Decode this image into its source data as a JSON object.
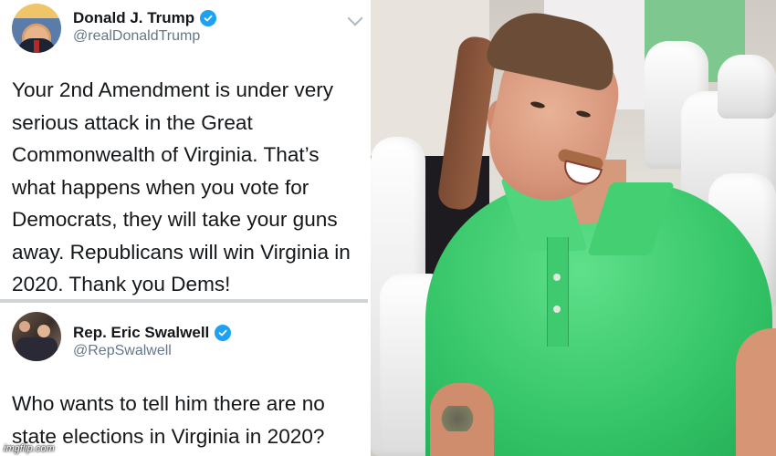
{
  "tweets": [
    {
      "name": "Donald J. Trump",
      "handle": "@realDonaldTrump",
      "text": "Your 2nd Amendment is under very serious attack in the Great Commonwealth of Virginia. That’s what happens when you vote for Democrats, they will take your guns away. Republicans will win Virginia in 2020. Thank you Dems!",
      "avatar_icon": "trump-avatar",
      "verified_icon": "verified-badge-icon"
    },
    {
      "name": "Rep. Eric Swalwell",
      "handle": "@RepSwalwell",
      "text": "Who wants to tell him there are no state elections in Virginia in 2020?",
      "avatar_icon": "swalwell-avatar",
      "verified_icon": "verified-badge-icon"
    }
  ],
  "photo": {
    "subject": "laughing-man-green-shirt"
  },
  "watermark": "imgflip.com",
  "colors": {
    "verified": "#1da1f2",
    "handle": "#657786",
    "text": "#14171a",
    "shirt": "#33c366"
  }
}
